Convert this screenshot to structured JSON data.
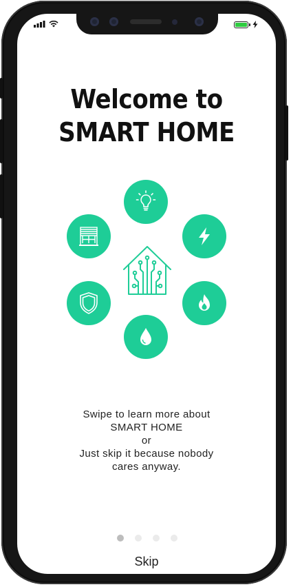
{
  "status_bar": {
    "icons": [
      "cellular-signal-icon",
      "wifi-icon",
      "battery-icon",
      "charging-bolt-icon"
    ],
    "battery_level": 1.0,
    "battery_color": "#2ecc40"
  },
  "onboarding": {
    "title_line1": "Welcome to",
    "title_line2": "SMART HOME",
    "accent_color": "#1ecd97",
    "feature_icons": [
      "lightbulb-icon",
      "power-bolt-icon",
      "flame-icon",
      "water-drop-icon",
      "shield-icon",
      "window-blinds-icon"
    ],
    "center_icon": "smart-house-icon",
    "message_lines": [
      "Swipe to learn more about",
      "SMART HOME",
      "or",
      "Just skip it because nobody",
      "cares anyway."
    ],
    "page_count": 4,
    "active_page": 1,
    "skip_label": "Skip"
  }
}
